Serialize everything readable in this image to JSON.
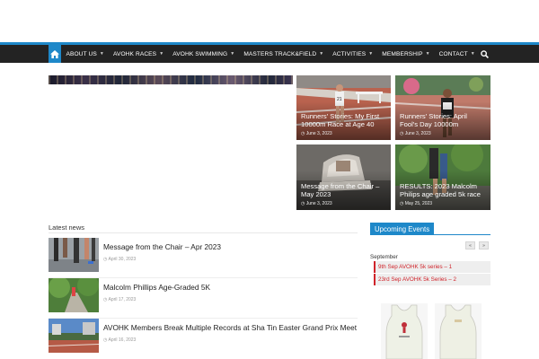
{
  "nav": {
    "home_icon": "home-icon",
    "items": [
      {
        "label": "ABOUT US"
      },
      {
        "label": "AVOHK RACES"
      },
      {
        "label": "AVOHK SWIMMING"
      },
      {
        "label": "MASTERS TRACK&FIELD"
      },
      {
        "label": "ACTIVITIES"
      },
      {
        "label": "MEMBERSHIP"
      },
      {
        "label": "CONTACT"
      }
    ],
    "search_icon": "search-icon"
  },
  "featured": [
    {
      "title": "Runners' Stories: My First 10000m Race at Age 40",
      "date": "June 3, 2023"
    },
    {
      "title": "Runners' Stories: April Fool's Day 10000m",
      "date": "June 3, 2023"
    },
    {
      "title": "Message from the Chair – May 2023",
      "date": "June 3, 2023"
    },
    {
      "title": "RESULTS: 2023 Malcolm Philips age graded 5k race",
      "date": "May 25, 2023"
    }
  ],
  "latest_news": {
    "heading": "Latest news",
    "items": [
      {
        "title": "Message from the Chair – Apr 2023",
        "date": "April 30, 2023"
      },
      {
        "title": "Malcolm Phillips Age-Graded 5K",
        "date": "April 17, 2023"
      },
      {
        "title": "AVOHK Members Break Multiple Records at Sha Tin Easter Grand Prix Meet",
        "date": "April 16, 2023"
      }
    ]
  },
  "events": {
    "heading": "Upcoming Events",
    "prev": "«",
    "next": "»",
    "month": "September",
    "items": [
      {
        "label": "9th Sep AVOHK 5k series – 1"
      },
      {
        "label": "23rd Sep AVOHK 5k Series – 2"
      }
    ]
  },
  "colors": {
    "accent": "#1e88c9",
    "nav_bg": "#232323",
    "event_red": "#d0232a"
  }
}
